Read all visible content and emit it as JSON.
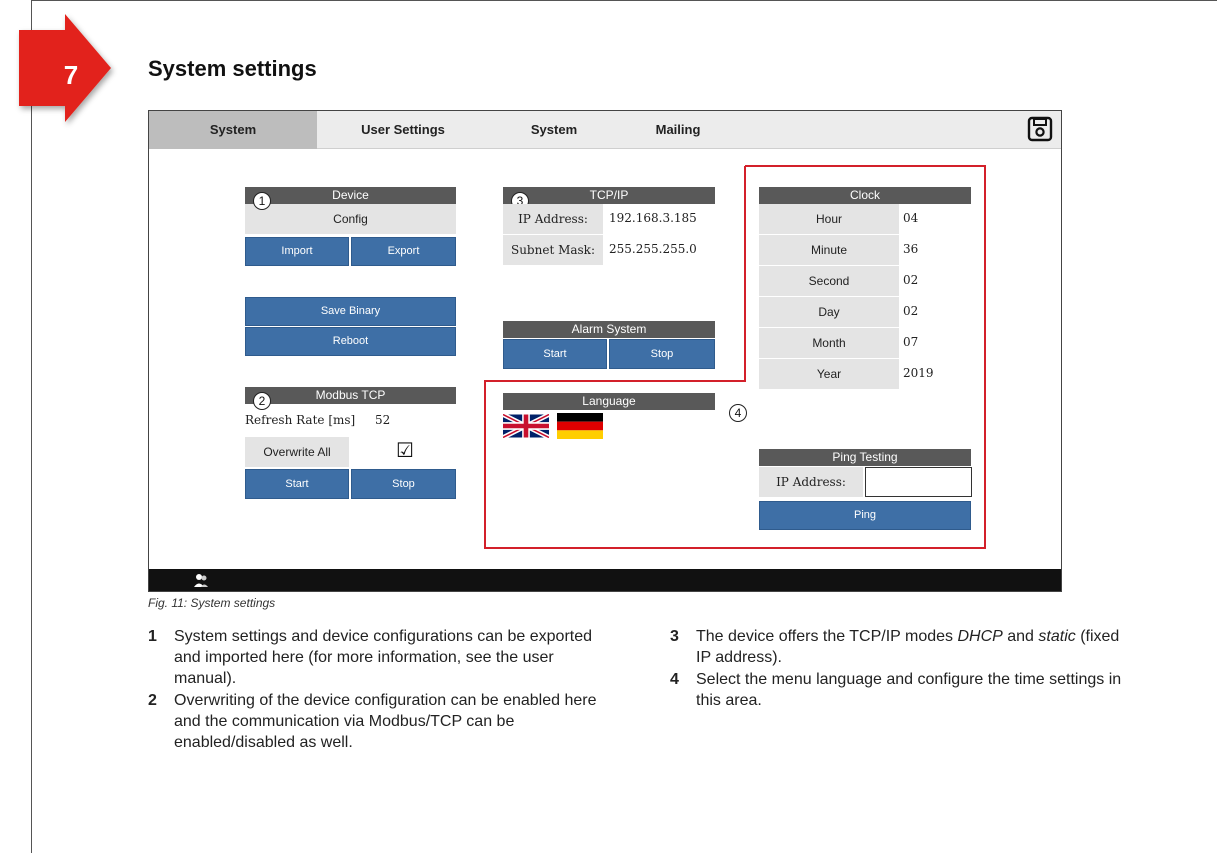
{
  "step": {
    "number": "7"
  },
  "page_title": "System settings",
  "tabs": [
    {
      "label": "System",
      "active": true
    },
    {
      "label": "User Settings",
      "active": false
    },
    {
      "label": "System",
      "active": false
    },
    {
      "label": "Mailing",
      "active": false
    }
  ],
  "device": {
    "header": "Device",
    "config_label": "Config",
    "import_label": "Import",
    "export_label": "Export",
    "save_binary_label": "Save Binary",
    "reboot_label": "Reboot",
    "callout": "1"
  },
  "modbus": {
    "header": "Modbus TCP",
    "refresh_label": "Refresh Rate [ms]",
    "refresh_value": "52",
    "overwrite_label": "Overwrite All",
    "overwrite_checked": "☑",
    "start_label": "Start",
    "stop_label": "Stop",
    "callout": "2"
  },
  "tcpip": {
    "header": "TCP/IP",
    "ip_label": "IP Address:",
    "ip_value": "192.168.3.185",
    "mask_label": "Subnet Mask:",
    "mask_value": "255.255.255.0",
    "callout": "3"
  },
  "alarm": {
    "header": "Alarm System",
    "start_label": "Start",
    "stop_label": "Stop"
  },
  "language": {
    "header": "Language",
    "flags": [
      "uk-flag-icon",
      "germany-flag-icon"
    ],
    "callout": "4"
  },
  "clock": {
    "header": "Clock",
    "rows": [
      {
        "label": "Hour",
        "value": "04"
      },
      {
        "label": "Minute",
        "value": "36"
      },
      {
        "label": "Second",
        "value": "02"
      },
      {
        "label": "Day",
        "value": "02"
      },
      {
        "label": "Month",
        "value": "07"
      },
      {
        "label": "Year",
        "value": "2019"
      }
    ]
  },
  "ping": {
    "header": "Ping Testing",
    "ip_label": "IP Address:",
    "ip_value": "",
    "button_label": "Ping"
  },
  "caption": "Fig. 11:  System settings",
  "descriptions": [
    {
      "num": "1",
      "text": "System settings and device configurations can be exported and imported here (for more information, see the user manual)."
    },
    {
      "num": "2",
      "text": "Overwriting of the device configuration can be enabled here and the communication via Modbus/TCP can be enabled/disabled as well."
    },
    {
      "num": "3",
      "text_before": "The device offers the TCP/IP modes ",
      "em1": "DHCP",
      "text_mid": " and ",
      "em2": "static",
      "text_after": " (fixed IP address)."
    },
    {
      "num": "4",
      "text": "Select the menu language and configure the time settings in this area."
    }
  ],
  "colors": {
    "button_blue": "#3e6fa6",
    "header_gray": "#595959",
    "highlight_red": "#d3202a",
    "badge_red": "#e2231a"
  }
}
